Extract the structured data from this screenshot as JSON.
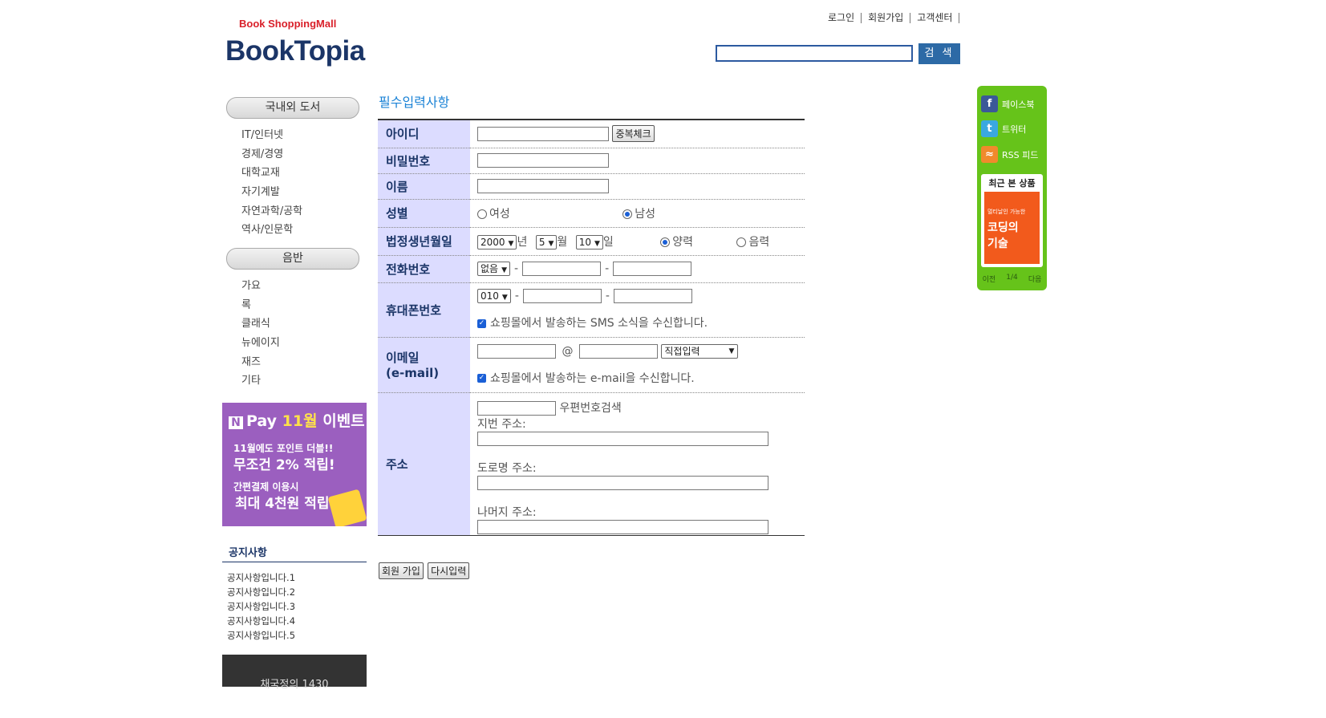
{
  "header": {
    "brand_sub": "Book ShoppingMall",
    "brand": "BookTopia",
    "nav": [
      "로그인",
      "회원가입",
      "고객센터"
    ],
    "search_button": "검 색"
  },
  "sidebar": {
    "category1": "국내외 도서",
    "books": [
      "IT/인터넷",
      "경제/경영",
      "대학교재",
      "자기계발",
      "자연과학/공학",
      "역사/인문학"
    ],
    "category2": "음반",
    "music": [
      "가요",
      "록",
      "클래식",
      "뉴에이지",
      "재즈",
      "기타"
    ],
    "promo": {
      "title_pay": "Pay",
      "title_month": "11월",
      "title_event": "이벤트",
      "line1": "11월에도 포인트 더블!!",
      "line2": "무조건 2% 적립!",
      "line3": "간편결제 이용시",
      "line4": "최대 4천원 적립!"
    },
    "notice_title": "공지사항",
    "notices": [
      "공지사항입니다.1",
      "공지사항입니다.2",
      "공지사항입니다.3",
      "공지사항입니다.4",
      "공지사항입니다.5"
    ],
    "dark_banner": "채국정의 1430"
  },
  "form": {
    "title": "필수입력사항",
    "id_label": "아이디",
    "dup_check": "중복체크",
    "password_label": "비밀번호",
    "name_label": "이름",
    "gender_label": "성별",
    "female": "여성",
    "male": "남성",
    "birth_label": "법정생년월일",
    "birth_year": "2000",
    "year_unit": "년",
    "birth_month": "5",
    "month_unit": "월",
    "birth_day": "10",
    "day_unit": "일",
    "solar": "양력",
    "lunar": "음력",
    "phone_label": "전화번호",
    "phone_prefix": "없음",
    "mobile_label": "휴대폰번호",
    "mobile_prefix": "010",
    "sms_consent": "쇼핑몰에서 발송하는 SMS 소식을 수신합니다.",
    "email_label": "이메일",
    "email_label2": "(e-mail)",
    "email_at": "@",
    "email_domain": "직접입력",
    "email_consent": "쇼핑몰에서 발송하는 e-mail을 수신합니다.",
    "address_label": "주소",
    "zip_search": "우편번호검색",
    "lot_address": "지번 주소:",
    "road_address": "도로명 주소:",
    "rest_address": "나머지 주소:",
    "submit": "회원 가입",
    "reset": "다시입력"
  },
  "side_widget": {
    "facebook": "페이스북",
    "twitter": "트위터",
    "rss": "RSS 피드",
    "recent_title": "최근 본 상품",
    "book_t0": "멀티날인 가능한",
    "book_t1": "코딩의",
    "book_t2": "기술",
    "prev": "이전",
    "page": "1/4",
    "next": "다음"
  }
}
